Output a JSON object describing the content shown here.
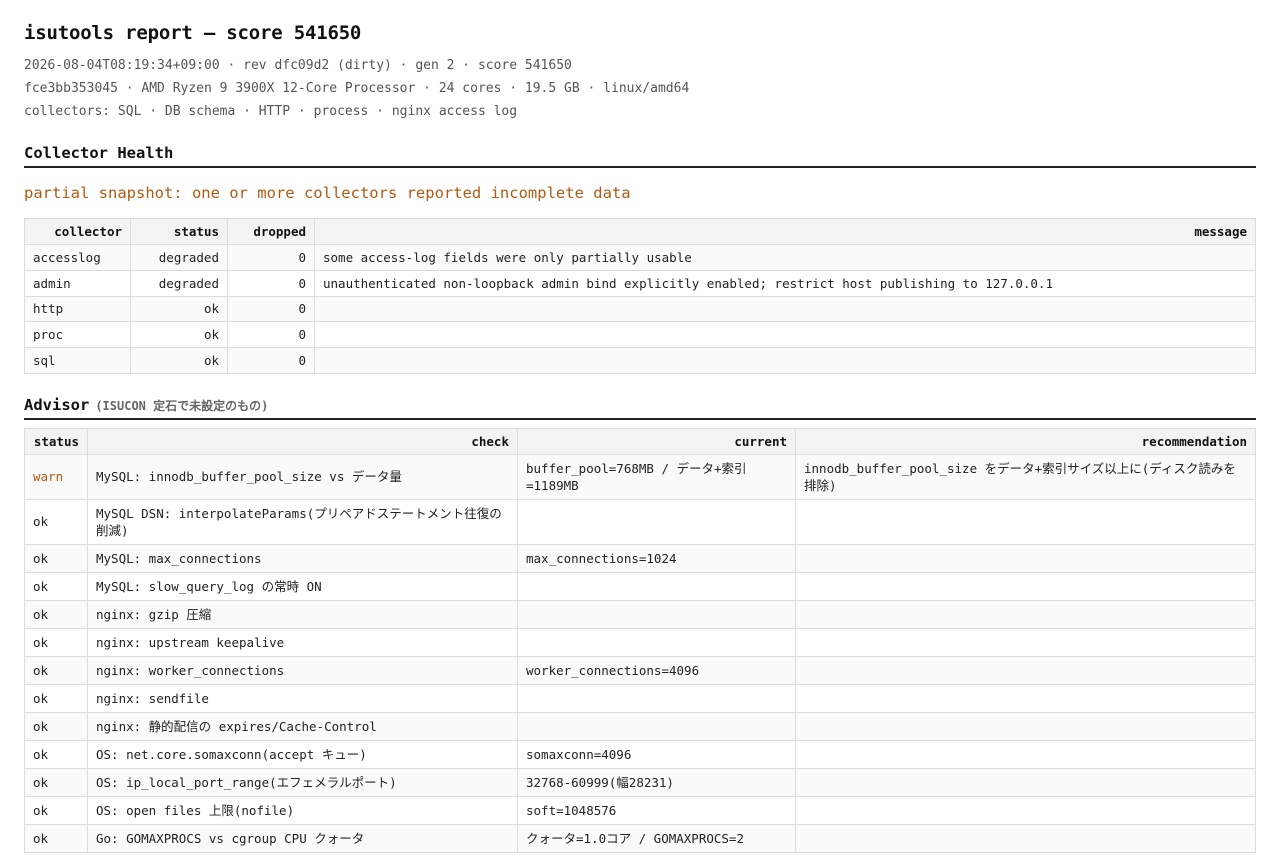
{
  "report": {
    "title": "isutools report — score 541650",
    "meta_line1": "2026-08-04T08:19:34+09:00 · rev dfc09d2 (dirty) · gen 2 · score 541650",
    "meta_line2": "fce3bb353045 · AMD Ryzen 9 3900X 12-Core Processor · 24 cores · 19.5 GB · linux/amd64",
    "meta_line3": "collectors: SQL · DB schema · HTTP · process · nginx access log"
  },
  "health": {
    "heading": "Collector Health",
    "warning": "partial snapshot: one or more collectors reported incomplete data",
    "columns": {
      "collector": "collector",
      "status": "status",
      "dropped": "dropped",
      "message": "message"
    },
    "rows": [
      {
        "collector": "accesslog",
        "status": "degraded",
        "dropped": "0",
        "message": "some access-log fields were only partially usable"
      },
      {
        "collector": "admin",
        "status": "degraded",
        "dropped": "0",
        "message": "unauthenticated non-loopback admin bind explicitly enabled; restrict host publishing to 127.0.0.1"
      },
      {
        "collector": "http",
        "status": "ok",
        "dropped": "0",
        "message": ""
      },
      {
        "collector": "proc",
        "status": "ok",
        "dropped": "0",
        "message": ""
      },
      {
        "collector": "sql",
        "status": "ok",
        "dropped": "0",
        "message": ""
      }
    ]
  },
  "advisor": {
    "heading": "Advisor",
    "subheading": "(ISUCON 定石で未設定のもの)",
    "columns": {
      "status": "status",
      "check": "check",
      "current": "current",
      "recommendation": "recommendation"
    },
    "rows": [
      {
        "status": "warn",
        "check": "MySQL: innodb_buffer_pool_size vs データ量",
        "current": "buffer_pool=768MB / データ+索引=1189MB",
        "recommendation": "innodb_buffer_pool_size をデータ+索引サイズ以上に(ディスク読みを排除)"
      },
      {
        "status": "ok",
        "check": "MySQL DSN: interpolateParams(プリペアドステートメント往復の削減)",
        "current": "",
        "recommendation": ""
      },
      {
        "status": "ok",
        "check": "MySQL: max_connections",
        "current": "max_connections=1024",
        "recommendation": ""
      },
      {
        "status": "ok",
        "check": "MySQL: slow_query_log の常時 ON",
        "current": "",
        "recommendation": ""
      },
      {
        "status": "ok",
        "check": "nginx: gzip 圧縮",
        "current": "",
        "recommendation": ""
      },
      {
        "status": "ok",
        "check": "nginx: upstream keepalive",
        "current": "",
        "recommendation": ""
      },
      {
        "status": "ok",
        "check": "nginx: worker_connections",
        "current": "worker_connections=4096",
        "recommendation": ""
      },
      {
        "status": "ok",
        "check": "nginx: sendfile",
        "current": "",
        "recommendation": ""
      },
      {
        "status": "ok",
        "check": "nginx: 静的配信の expires/Cache-Control",
        "current": "",
        "recommendation": ""
      },
      {
        "status": "ok",
        "check": "OS: net.core.somaxconn(accept キュー)",
        "current": "somaxconn=4096",
        "recommendation": ""
      },
      {
        "status": "ok",
        "check": "OS: ip_local_port_range(エフェメラルポート)",
        "current": "32768-60999(幅28231)",
        "recommendation": ""
      },
      {
        "status": "ok",
        "check": "OS: open files 上限(nofile)",
        "current": "soft=1048576",
        "recommendation": ""
      },
      {
        "status": "ok",
        "check": "Go: GOMAXPROCS vs cgroup CPU クォータ",
        "current": "クォータ=1.0コア / GOMAXPROCS=2",
        "recommendation": ""
      }
    ]
  },
  "colors": {
    "warn": "#b25a12",
    "rule": "#222222"
  }
}
